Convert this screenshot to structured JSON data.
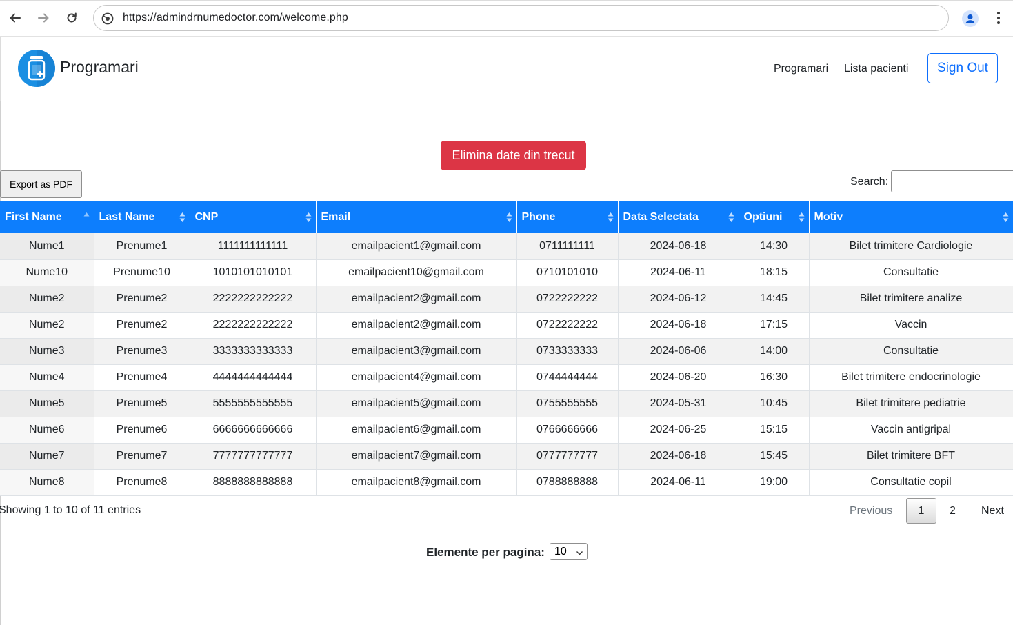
{
  "browser": {
    "url": "https://admindrnumedoctor.com/welcome.php"
  },
  "navbar": {
    "brand": "Programari",
    "links": [
      "Programari",
      "Lista pacienti"
    ],
    "signout": "Sign Out"
  },
  "actions": {
    "delete_past": "Elimina date din trecut",
    "export_pdf": "Export as PDF",
    "search_label": "Search:",
    "search_value": ""
  },
  "table": {
    "columns": [
      "First Name",
      "Last Name",
      "CNP",
      "Email",
      "Phone",
      "Data Selectata",
      "Optiuni",
      "Motiv"
    ],
    "sorted_column": "First Name",
    "sorted_direction": "ascending",
    "rows": [
      [
        "Nume1",
        "Prenume1",
        "1111111111111",
        "emailpacient1@gmail.com",
        "0711111111",
        "2024-06-18",
        "14:30",
        "Bilet trimitere Cardiologie"
      ],
      [
        "Nume10",
        "Prenume10",
        "1010101010101",
        "emailpacient10@gmail.com",
        "0710101010",
        "2024-06-11",
        "18:15",
        "Consultatie"
      ],
      [
        "Nume2",
        "Prenume2",
        "2222222222222",
        "emailpacient2@gmail.com",
        "0722222222",
        "2024-06-12",
        "14:45",
        "Bilet trimitere analize"
      ],
      [
        "Nume2",
        "Prenume2",
        "2222222222222",
        "emailpacient2@gmail.com",
        "0722222222",
        "2024-06-18",
        "17:15",
        "Vaccin"
      ],
      [
        "Nume3",
        "Prenume3",
        "3333333333333",
        "emailpacient3@gmail.com",
        "0733333333",
        "2024-06-06",
        "14:00",
        "Consultatie"
      ],
      [
        "Nume4",
        "Prenume4",
        "4444444444444",
        "emailpacient4@gmail.com",
        "0744444444",
        "2024-06-20",
        "16:30",
        "Bilet trimitere endocrinologie"
      ],
      [
        "Nume5",
        "Prenume5",
        "5555555555555",
        "emailpacient5@gmail.com",
        "0755555555",
        "2024-05-31",
        "10:45",
        "Bilet trimitere pediatrie"
      ],
      [
        "Nume6",
        "Prenume6",
        "6666666666666",
        "emailpacient6@gmail.com",
        "0766666666",
        "2024-06-25",
        "15:15",
        "Vaccin antigripal"
      ],
      [
        "Nume7",
        "Prenume7",
        "7777777777777",
        "emailpacient7@gmail.com",
        "0777777777",
        "2024-06-18",
        "15:45",
        "Bilet trimitere BFT"
      ],
      [
        "Nume8",
        "Prenume8",
        "8888888888888",
        "emailpacient8@gmail.com",
        "0788888888",
        "2024-06-11",
        "19:00",
        "Consultatie copil"
      ]
    ]
  },
  "footer": {
    "info": "Showing 1 to 10 of 11 entries",
    "previous": "Previous",
    "pages": [
      "1",
      "2"
    ],
    "current_page": "1",
    "next": "Next",
    "per_page_label": "Elemente per pagina:",
    "per_page_value": "10"
  },
  "colors": {
    "header_blue": "#0d7efd",
    "danger": "#dc3545",
    "primary": "#0d6efd"
  }
}
